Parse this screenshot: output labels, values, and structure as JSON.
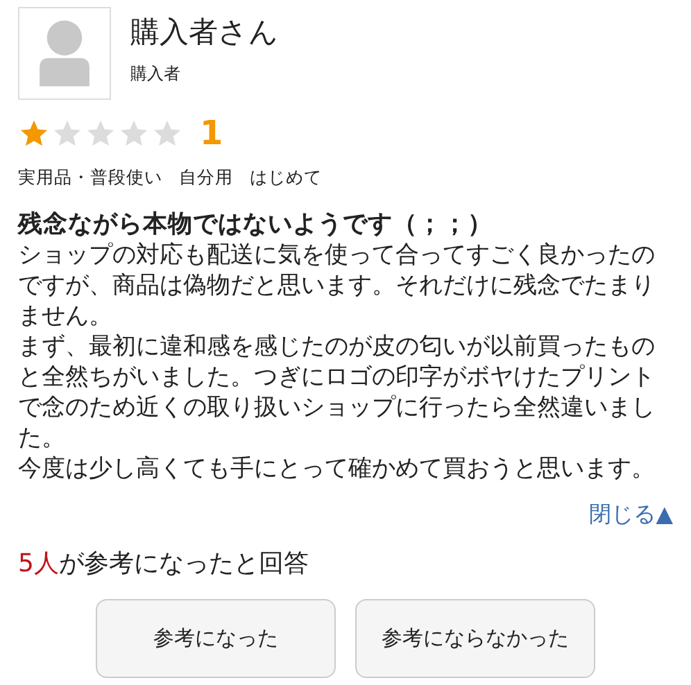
{
  "reviewer": {
    "name": "購入者さん",
    "role": "購入者"
  },
  "rating": {
    "stars": 1,
    "value": "1"
  },
  "tags": [
    "実用品・普段使い",
    "自分用",
    "はじめて"
  ],
  "review": {
    "title": "残念ながら本物ではないようです（；；）",
    "paragraphs": [
      "ショップの対応も配送に気を使って合ってすごく良かったのですが、商品は偽物だと思います。それだけに残念でたまりません。",
      "まず、最初に違和感を感じたのが皮の匂いが以前買ったものと全然ちがいました。つぎにロゴの印字がボヤけたプリントで念のため近くの取り扱いショップに行ったら全然違いました。",
      "今度は少し高くても手にとって確かめて買おうと思います。"
    ]
  },
  "collapse_link": "閉じる▲",
  "helpful": {
    "count": "5人",
    "text": "が参考になったと回答"
  },
  "buttons": [
    "参考になった",
    "参考にならなかった"
  ]
}
